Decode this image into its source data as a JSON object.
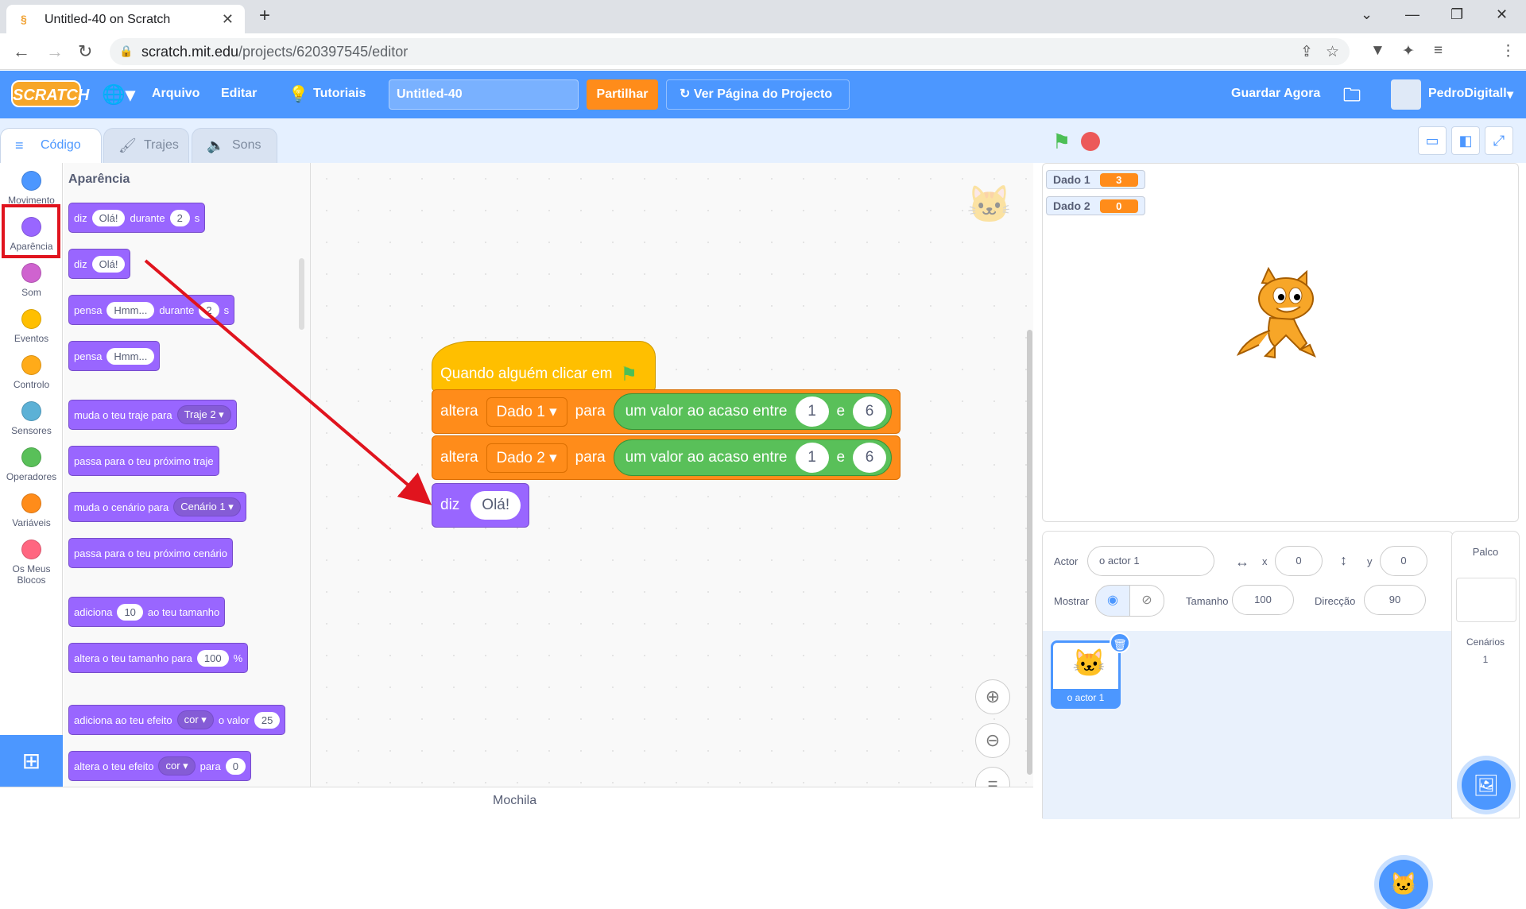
{
  "browser": {
    "tab_title": "Untitled-40 on Scratch",
    "url_domain": "scratch.mit.edu",
    "url_path": "/projects/620397545/editor"
  },
  "menubar": {
    "logo": "SCRATCH",
    "file": "Arquivo",
    "edit": "Editar",
    "tutorials": "Tutoriais",
    "project_title": "Untitled-40",
    "share": "Partilhar",
    "see_project": "Ver Página do Projecto",
    "save_now": "Guardar Agora",
    "username": "PedroDigitall"
  },
  "tabs": {
    "code": "Código",
    "costumes": "Trajes",
    "sounds": "Sons"
  },
  "categories": [
    {
      "label": "Movimento",
      "color": "#4c97ff"
    },
    {
      "label": "Aparência",
      "color": "#9966ff"
    },
    {
      "label": "Som",
      "color": "#cf63cf"
    },
    {
      "label": "Eventos",
      "color": "#ffbf00"
    },
    {
      "label": "Controlo",
      "color": "#ffab19"
    },
    {
      "label": "Sensores",
      "color": "#5cb1d6"
    },
    {
      "label": "Operadores",
      "color": "#59c059"
    },
    {
      "label": "Variáveis",
      "color": "#ff8c1a"
    },
    {
      "label": "Os Meus Blocos",
      "color": "#ff6680"
    }
  ],
  "palette": {
    "title": "Aparência",
    "b1": {
      "a": "diz",
      "v1": "Olá!",
      "b": "durante",
      "v2": "2",
      "c": "s"
    },
    "b2": {
      "a": "diz",
      "v1": "Olá!"
    },
    "b3": {
      "a": "pensa",
      "v1": "Hmm...",
      "b": "durante",
      "v2": "2",
      "c": "s"
    },
    "b4": {
      "a": "pensa",
      "v1": "Hmm..."
    },
    "b5": {
      "a": "muda o teu traje para",
      "v1": "Traje 2 ▾"
    },
    "b6": {
      "a": "passa para o teu próximo traje"
    },
    "b7": {
      "a": "muda o cenário para",
      "v1": "Cenário 1 ▾"
    },
    "b8": {
      "a": "passa para o teu próximo cenário"
    },
    "b9": {
      "a": "adiciona",
      "v1": "10",
      "b": "ao teu tamanho"
    },
    "b10": {
      "a": "altera o teu tamanho para",
      "v1": "100",
      "b": "%"
    },
    "b11": {
      "a": "adiciona ao teu efeito",
      "v1": "cor ▾",
      "b": "o valor",
      "v2": "25"
    },
    "b12": {
      "a": "altera o teu efeito",
      "v1": "cor ▾",
      "b": "para",
      "v2": "0"
    }
  },
  "script": {
    "hat": "Quando alguém clicar em",
    "set1": {
      "a": "altera",
      "var": "Dado 1 ▾",
      "b": "para",
      "op": "um valor ao acaso entre",
      "n1": "1",
      "e": "e",
      "n2": "6"
    },
    "set2": {
      "a": "altera",
      "var": "Dado 2 ▾",
      "b": "para",
      "op": "um valor ao acaso entre",
      "n1": "1",
      "e": "e",
      "n2": "6"
    },
    "say": {
      "a": "diz",
      "v": "Olá!"
    }
  },
  "backpack": "Mochila",
  "monitors": [
    {
      "name": "Dado 1",
      "value": "3"
    },
    {
      "name": "Dado 2",
      "value": "0"
    }
  ],
  "sprite_info": {
    "actor_label": "Actor",
    "actor_name": "o actor 1",
    "x_label": "x",
    "x": "0",
    "y_label": "y",
    "y": "0",
    "show_label": "Mostrar",
    "size_label": "Tamanho",
    "size": "100",
    "direction_label": "Direcção",
    "direction": "90",
    "sprite_name": "o actor 1"
  },
  "stage_pane": {
    "title": "Palco",
    "backdrops_label": "Cenários",
    "backdrops_count": "1"
  },
  "colors": {
    "accent": "#4c97ff",
    "looks": "#9966ff",
    "variables": "#ff8c1a",
    "operators": "#59c059",
    "events": "#ffbf00",
    "annotation": "#e0141e"
  }
}
